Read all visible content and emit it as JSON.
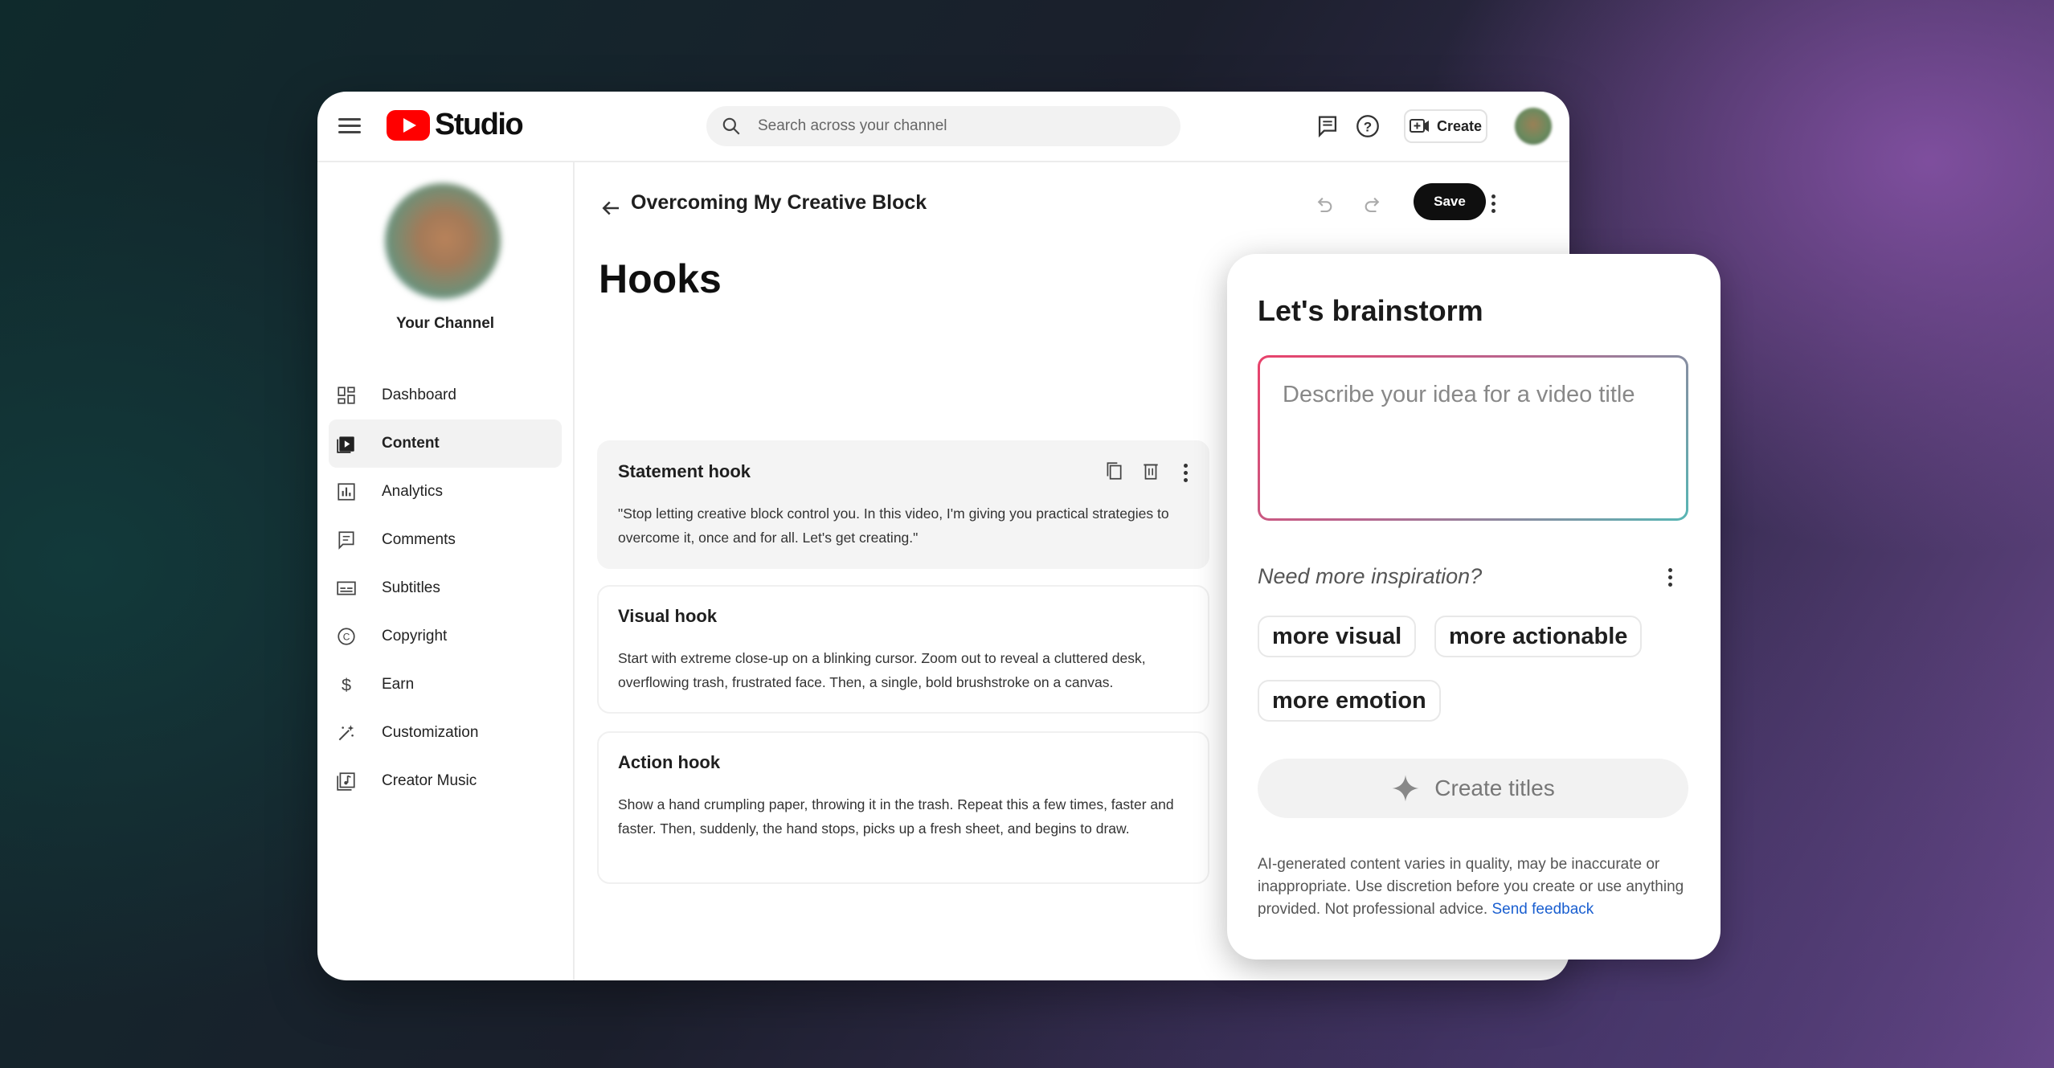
{
  "app": {
    "logo_text": "Studio"
  },
  "search": {
    "placeholder": "Search across your channel"
  },
  "header": {
    "create_label": "Create"
  },
  "sidebar": {
    "channel_name": "Your Channel",
    "items": [
      {
        "label": "Dashboard",
        "icon": "dashboard-icon"
      },
      {
        "label": "Content",
        "icon": "content-icon",
        "active": true
      },
      {
        "label": "Analytics",
        "icon": "analytics-icon"
      },
      {
        "label": "Comments",
        "icon": "comments-icon"
      },
      {
        "label": "Subtitles",
        "icon": "subtitles-icon"
      },
      {
        "label": "Copyright",
        "icon": "copyright-icon"
      },
      {
        "label": "Earn",
        "icon": "dollar-icon"
      },
      {
        "label": "Customization",
        "icon": "wand-icon"
      },
      {
        "label": "Creator Music",
        "icon": "music-icon"
      }
    ]
  },
  "document": {
    "title": "Overcoming My Creative Block",
    "save_label": "Save",
    "heading": "Hooks",
    "hooks": [
      {
        "title": "Statement hook",
        "text": "\"Stop letting creative block control you.  In this video, I'm giving you practical strategies to overcome it, once and for all.  Let's get creating.\""
      },
      {
        "title": "Visual hook",
        "text": "Start with extreme close-up on a blinking cursor. Zoom out to reveal a cluttered desk, overflowing trash, frustrated face.  Then, a single, bold brushstroke on a canvas."
      },
      {
        "title": "Action hook",
        "text": "Show a hand crumpling paper, throwing it in the trash. Repeat this a few times, faster and faster. Then, suddenly, the hand stops, picks up a fresh sheet, and begins to draw."
      }
    ]
  },
  "brainstorm": {
    "title": "Let's brainstorm",
    "placeholder": "Describe your idea for a video title",
    "inspiration_label": "Need more inspiration?",
    "chips": [
      "more visual",
      "more actionable",
      "more emotion"
    ],
    "create_titles_label": "Create titles",
    "disclaimer": "AI-generated content varies in quality, may be inaccurate or inappropriate. Use discretion before you create or use anything provided. Not professional advice.",
    "feedback_link": "Send feedback"
  },
  "colors": {
    "brand_red": "#ff0000",
    "link_blue": "#1a5fd0",
    "save_button": "#0f0f0f"
  }
}
